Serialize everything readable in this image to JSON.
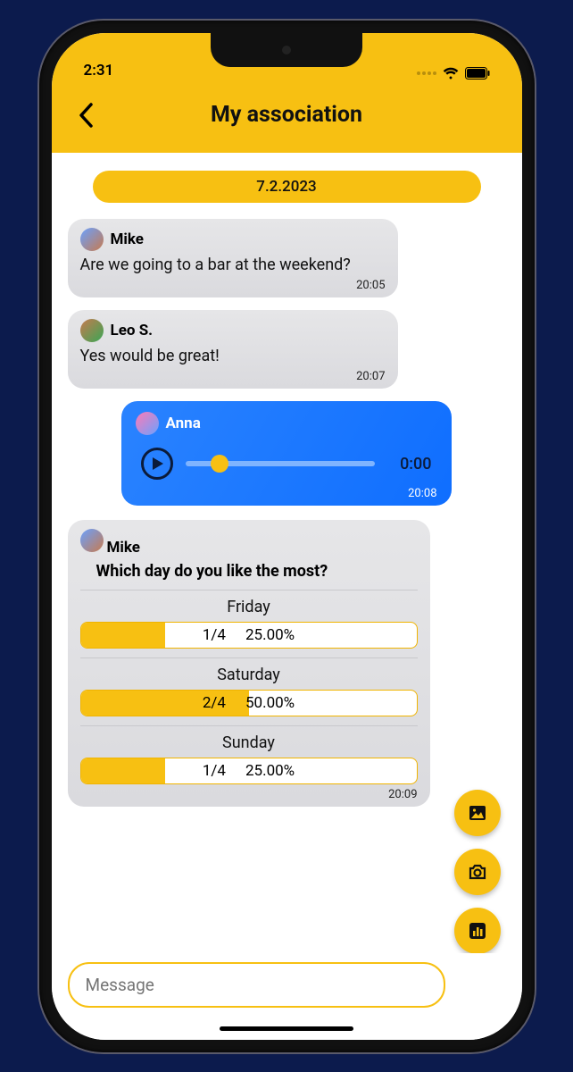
{
  "status": {
    "time": "2:31"
  },
  "header": {
    "title": "My association"
  },
  "date_pill": "7.2.2023",
  "messages": {
    "m1": {
      "sender": "Mike",
      "text": "Are we going to a bar at the weekend?",
      "time": "20:05"
    },
    "m2": {
      "sender": "Leo S.",
      "text": "Yes would be great!",
      "time": "20:07"
    },
    "voice": {
      "sender": "Anna",
      "duration": "0:00",
      "time": "20:08"
    },
    "poll": {
      "sender": "Mike",
      "question": "Which day do you like the most?",
      "options": [
        {
          "label": "Friday",
          "count": "1/4",
          "pct": "25.00%",
          "fill": 25
        },
        {
          "label": "Saturday",
          "count": "2/4",
          "pct": "50.00%",
          "fill": 50
        },
        {
          "label": "Sunday",
          "count": "1/4",
          "pct": "25.00%",
          "fill": 25
        }
      ],
      "time": "20:09"
    }
  },
  "input": {
    "placeholder": "Message"
  }
}
